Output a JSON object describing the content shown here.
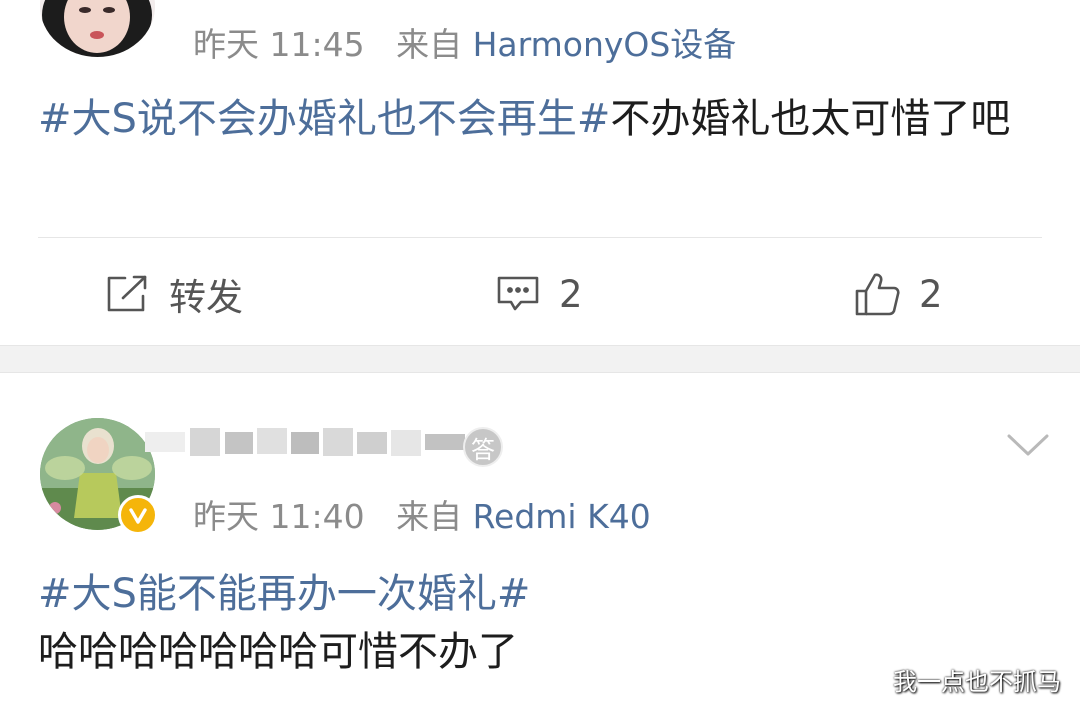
{
  "post1": {
    "time": "昨天 11:45",
    "source_prefix": "来自",
    "source": "HarmonyOS设备",
    "hashtag": "#大S说不会办婚礼也不会再生#",
    "text": "不办婚礼也太可惜了吧",
    "actions": {
      "repost_label": "转发",
      "comment_count": "2",
      "like_count": "2"
    }
  },
  "post2": {
    "badge_char": "答",
    "time": "昨天 11:40",
    "source_prefix": "来自",
    "source": "Redmi K40",
    "hashtag": "#大S能不能再办一次婚礼#",
    "text": "哈哈哈哈哈哈哈可惜不办了"
  },
  "watermark": "我一点也不抓马",
  "colors": {
    "link": "#4d6e9a",
    "meta": "#8b8b8b",
    "separator": "#f2f2f2",
    "verified": "#f5b50a"
  }
}
